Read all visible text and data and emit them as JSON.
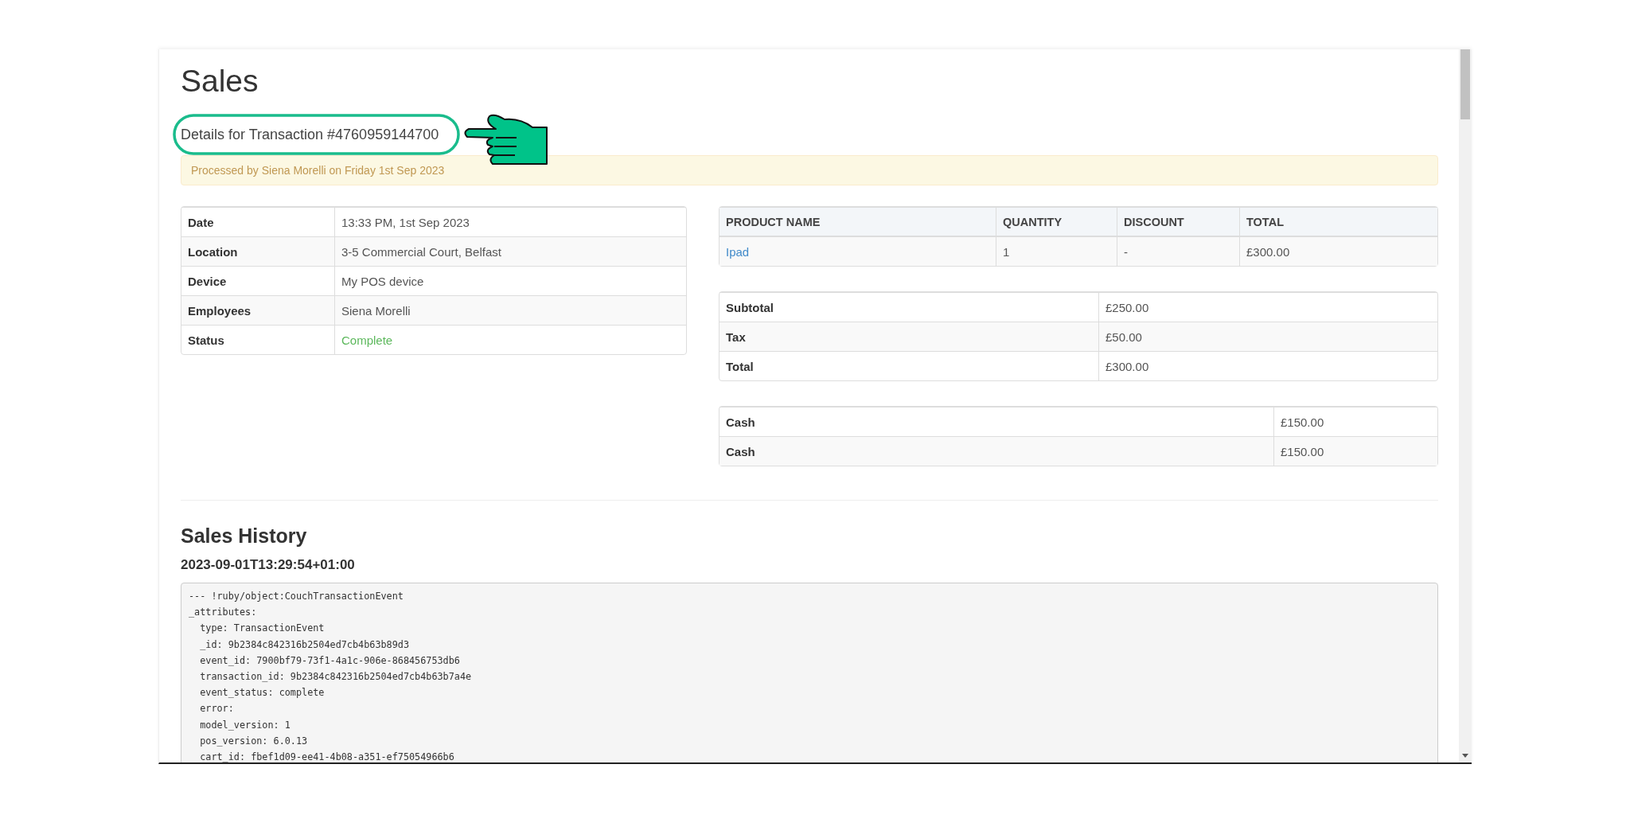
{
  "page": {
    "title": "Sales",
    "subtitle": "Details for Transaction #4760959144700",
    "alert": "Processed by Siena Morelli on Friday 1st Sep 2023"
  },
  "details": [
    {
      "label": "Date",
      "value": "13:33 PM, 1st Sep 2023",
      "kind": "text"
    },
    {
      "label": "Location",
      "value": "3-5 Commercial Court, Belfast",
      "kind": "text"
    },
    {
      "label": "Device",
      "value": "My POS device",
      "kind": "text"
    },
    {
      "label": "Employees",
      "value": "Siena Morelli",
      "kind": "text"
    },
    {
      "label": "Status",
      "value": "Complete",
      "kind": "status"
    }
  ],
  "products": {
    "columns": [
      "PRODUCT NAME",
      "QUANTITY",
      "DISCOUNT",
      "TOTAL"
    ],
    "rows": [
      {
        "product_name": "Ipad",
        "quantity": "1",
        "discount": "-",
        "total": "£300.00"
      }
    ]
  },
  "totals": [
    {
      "label": "Subtotal",
      "value": "£250.00"
    },
    {
      "label": "Tax",
      "value": "£50.00"
    },
    {
      "label": "Total",
      "value": "£300.00"
    }
  ],
  "payments": [
    {
      "label": "Cash",
      "value": "£150.00"
    },
    {
      "label": "Cash",
      "value": "£150.00"
    }
  ],
  "history": {
    "title": "Sales History",
    "entries": [
      {
        "timestamp": "2023-09-01T13:29:54+01:00",
        "lines": [
          "--- !ruby/object:CouchTransactionEvent",
          "_attributes:",
          "  type: TransactionEvent",
          "  _id: 9b2384c842316b2504ed7cb4b63b89d3",
          "  event_id: 7900bf79-73f1-4a1c-906e-868456753db6",
          "  transaction_id: 9b2384c842316b2504ed7cb4b63b7a4e",
          "  event_status: complete",
          "  error:",
          "  model_version: 1",
          "  pos_version: 6.0.13",
          "  cart_id: fbef1d09-ee41-4b08-a351-ef75054966b6"
        ]
      }
    ]
  }
}
